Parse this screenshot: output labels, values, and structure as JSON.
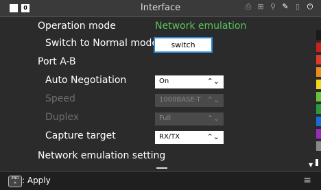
{
  "header": {
    "title": "Interface",
    "badge": "0",
    "status_icons": [
      "printer-icon",
      "network-icon",
      "usb-icon",
      "tool-icon",
      "battery-icon",
      "power-plug-icon"
    ]
  },
  "settings": {
    "operation_mode": {
      "label": "Operation mode",
      "value": "Network emulation"
    },
    "switch_normal": {
      "label": "Switch to Normal mode",
      "button": "switch"
    },
    "port_section": {
      "label": "Port A-B"
    },
    "auto_negotiation": {
      "label": "Auto Negotiation",
      "value": "On"
    },
    "speed": {
      "label": "Speed",
      "value": "1000BASE-T"
    },
    "duplex": {
      "label": "Duplex",
      "value": "Full"
    },
    "capture_target": {
      "label": "Capture target",
      "value": "RX/TX"
    },
    "network_emulation": {
      "label": "Network emulation setting"
    }
  },
  "footer": {
    "key": "END\n✕",
    "action": ": Apply"
  },
  "colors": {
    "accent_green": "#57c55b",
    "focus_blue": "#2a8ad8",
    "stripe": [
      "#1a1a1a",
      "#c81f1f",
      "#e03a2a",
      "#f08a1a",
      "#f0d81a",
      "#6ac23a",
      "#2a9a3a",
      "#1a6ad8",
      "#9a2ab8",
      "#888888",
      "#ffffff"
    ]
  }
}
